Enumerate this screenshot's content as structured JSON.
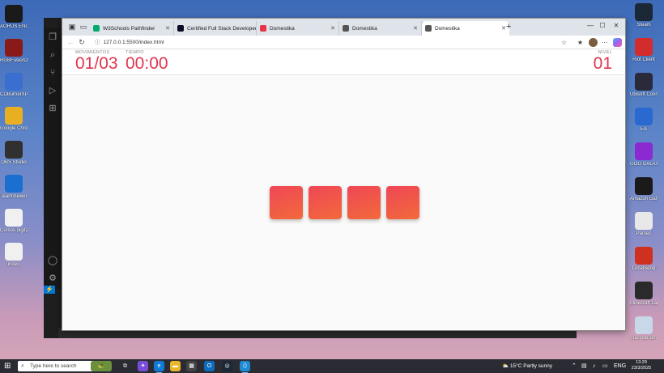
{
  "desktop": {
    "left_icons": [
      {
        "label": "AORUS ENGINE",
        "icon": "aorus-icon",
        "color": "#1a1a1a"
      },
      {
        "label": "RGBFusion2.0",
        "icon": "rgb-fusion-icon",
        "color": "#8a1a1a"
      },
      {
        "label": "CDBurnerXP",
        "icon": "cdburner-icon",
        "color": "#3a6fd0"
      },
      {
        "label": "Google Chrome",
        "icon": "chrome-icon",
        "color": "#e8b020"
      },
      {
        "label": "OBS Studio",
        "icon": "obs-icon",
        "color": "#303030"
      },
      {
        "label": "TeamViewer",
        "icon": "teamviewer-icon",
        "color": "#1a6fd0"
      },
      {
        "label": "Cursos digitales",
        "icon": "file-icon",
        "color": "#f0f0f0"
      },
      {
        "label": "index",
        "icon": "html-file-icon",
        "color": "#f0f0f0"
      }
    ],
    "right_icons": [
      {
        "label": "Steam",
        "icon": "steam-icon",
        "color": "#1b2838"
      },
      {
        "label": "Riot Client",
        "icon": "riot-icon",
        "color": "#d32c2c"
      },
      {
        "label": "Ubisoft Connect",
        "icon": "ubisoft-icon",
        "color": "#2a2a3a"
      },
      {
        "label": "EA",
        "icon": "ea-icon",
        "color": "#2a6ad0"
      },
      {
        "label": "GOG GALAXY",
        "icon": "gog-icon",
        "color": "#8a2ad0"
      },
      {
        "label": "Amazon Games",
        "icon": "amazon-games-icon",
        "color": "#1a1a1a"
      },
      {
        "label": "Parsec",
        "icon": "parsec-icon",
        "color": "#e8e8e8"
      },
      {
        "label": "LocalSend",
        "icon": "localsend-icon",
        "color": "#d03020"
      },
      {
        "label": "Minecraft Launcher",
        "icon": "minecraft-icon",
        "color": "#2a2a2a"
      },
      {
        "label": "Recycle Bin",
        "icon": "recycle-bin-icon",
        "color": "#c8d8e8"
      }
    ]
  },
  "browser": {
    "tabs": [
      {
        "title": "W3Schools Pathfinder",
        "favicon": "w3schools-favicon",
        "color": "#04aa6d",
        "active": false
      },
      {
        "title": "Certified Full Stack Developer Cu",
        "favicon": "freecodecamp-favicon",
        "color": "#0a0a23",
        "active": false
      },
      {
        "title": "Domestika",
        "favicon": "domestika-favicon",
        "color": "#e8334a",
        "active": false
      },
      {
        "title": "Domestika",
        "favicon": "globe-favicon",
        "color": "#555555",
        "active": false
      },
      {
        "title": "Domestika",
        "favicon": "globe-favicon",
        "color": "#555555",
        "active": true
      }
    ],
    "address": "127.0.0.1:5500/index.html"
  },
  "game": {
    "moves_label": "MOVIMIENTOS",
    "moves_value": "01/03",
    "time_label": "TIEMPO",
    "time_value": "00:00",
    "level_label": "NIVEL",
    "level_value": "01",
    "tile_count": 4,
    "accent_color": "#e0364e"
  },
  "taskbar": {
    "search_placeholder": "Type here to search",
    "weather": "15°C  Partly sunny",
    "language": "ENG",
    "time": "13:29",
    "date": "23/3/2025"
  }
}
